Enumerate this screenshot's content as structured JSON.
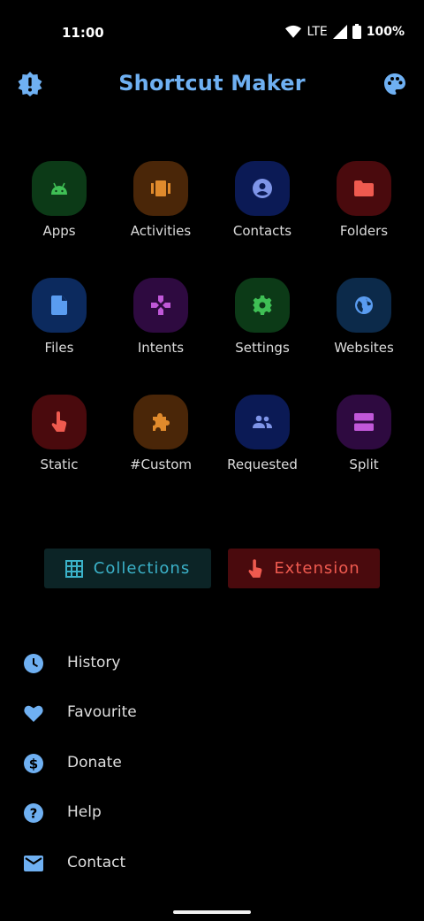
{
  "status_bar": {
    "time": "11:00",
    "network": "LTE",
    "battery": "100%"
  },
  "app_bar": {
    "title": "Shortcut Maker",
    "left_icon": "badge-alert-icon",
    "right_icon": "palette-icon",
    "accent": "#6fb0f2"
  },
  "grid": [
    {
      "label": "Apps",
      "icon": "android-icon",
      "bg": "#0c3a17",
      "fg": "#3fbf55"
    },
    {
      "label": "Activities",
      "icon": "carousel-icon",
      "bg": "#4a2608",
      "fg": "#e08a2c"
    },
    {
      "label": "Contacts",
      "icon": "account-circle-icon",
      "bg": "#0b1a55",
      "fg": "#7f95e8"
    },
    {
      "label": "Folders",
      "icon": "folder-icon",
      "bg": "#4a0a0d",
      "fg": "#ef5a4f"
    },
    {
      "label": "Files",
      "icon": "file-icon",
      "bg": "#0c2a5e",
      "fg": "#5a9cf0"
    },
    {
      "label": "Intents",
      "icon": "gamepad-icon",
      "bg": "#2e0a40",
      "fg": "#c058d8"
    },
    {
      "label": "Settings",
      "icon": "gear-icon",
      "bg": "#0c3a17",
      "fg": "#3fbf55"
    },
    {
      "label": "Websites",
      "icon": "globe-icon",
      "bg": "#0c2a4a",
      "fg": "#5a9cf0"
    },
    {
      "label": "Static",
      "icon": "touch-icon",
      "bg": "#4a0a0d",
      "fg": "#ef5a4f"
    },
    {
      "label": "#Custom",
      "icon": "puzzle-icon",
      "bg": "#4a2608",
      "fg": "#e08a2c"
    },
    {
      "label": "Requested",
      "icon": "group-icon",
      "bg": "#0b1a55",
      "fg": "#7f95e8"
    },
    {
      "label": "Split",
      "icon": "split-icon",
      "bg": "#2e0a40",
      "fg": "#c058d8"
    }
  ],
  "buttons": {
    "collections": {
      "label": "Collections",
      "icon": "grid-icon"
    },
    "extension": {
      "label": "Extension",
      "icon": "touch-icon"
    }
  },
  "menu": [
    {
      "label": "History",
      "icon": "clock-icon"
    },
    {
      "label": "Favourite",
      "icon": "heart-icon"
    },
    {
      "label": "Donate",
      "icon": "dollar-icon"
    },
    {
      "label": "Help",
      "icon": "help-icon"
    },
    {
      "label": "Contact",
      "icon": "mail-icon"
    }
  ],
  "menu_icon_color": "#6fb0f2"
}
